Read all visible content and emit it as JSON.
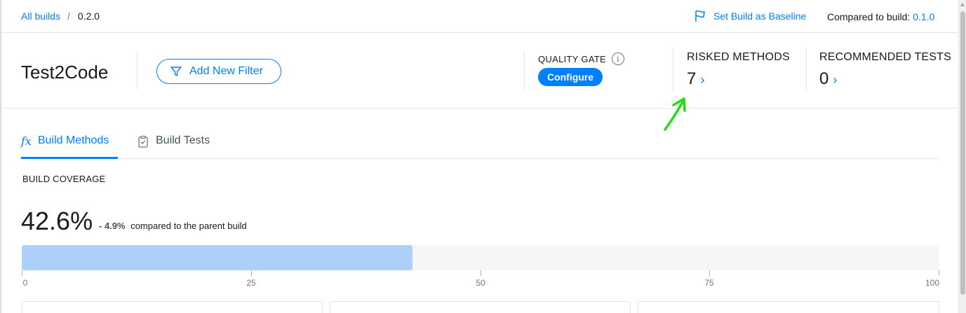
{
  "breadcrumb": {
    "root": "All builds",
    "separator": "/",
    "current": "0.2.0"
  },
  "topbar": {
    "baseline_label": "Set Build as Baseline",
    "compared_prefix": "Compared to build:",
    "compared_version": "0.1.0"
  },
  "header": {
    "title": "Test2Code",
    "filter_button": "Add New Filter",
    "quality_gate": {
      "label": "QUALITY GATE",
      "info_glyph": "i",
      "configure": "Configure"
    },
    "risked_methods": {
      "label": "RISKED METHODS",
      "value": "7",
      "chevron": "›"
    },
    "recommended_tests": {
      "label": "RECOMMENDED TESTS",
      "value": "0",
      "chevron": "›"
    }
  },
  "tabs": [
    {
      "label": "Build Methods",
      "icon": "fx-icon",
      "icon_glyph": "fx",
      "active": true
    },
    {
      "label": "Build Tests",
      "icon": "clipboard-check-icon",
      "active": false
    }
  ],
  "coverage": {
    "title": "BUILD COVERAGE",
    "value": "42.6%",
    "fraction": 0.426,
    "delta": "- 4.9%",
    "delta_text": "compared to the parent build",
    "ticks": [
      "0",
      "25",
      "50",
      "75",
      "100"
    ]
  },
  "colors": {
    "accent": "#007fff",
    "coverage_fill": "#add0fb",
    "track": "#f4f6f7",
    "annotation": "#22dd11"
  }
}
